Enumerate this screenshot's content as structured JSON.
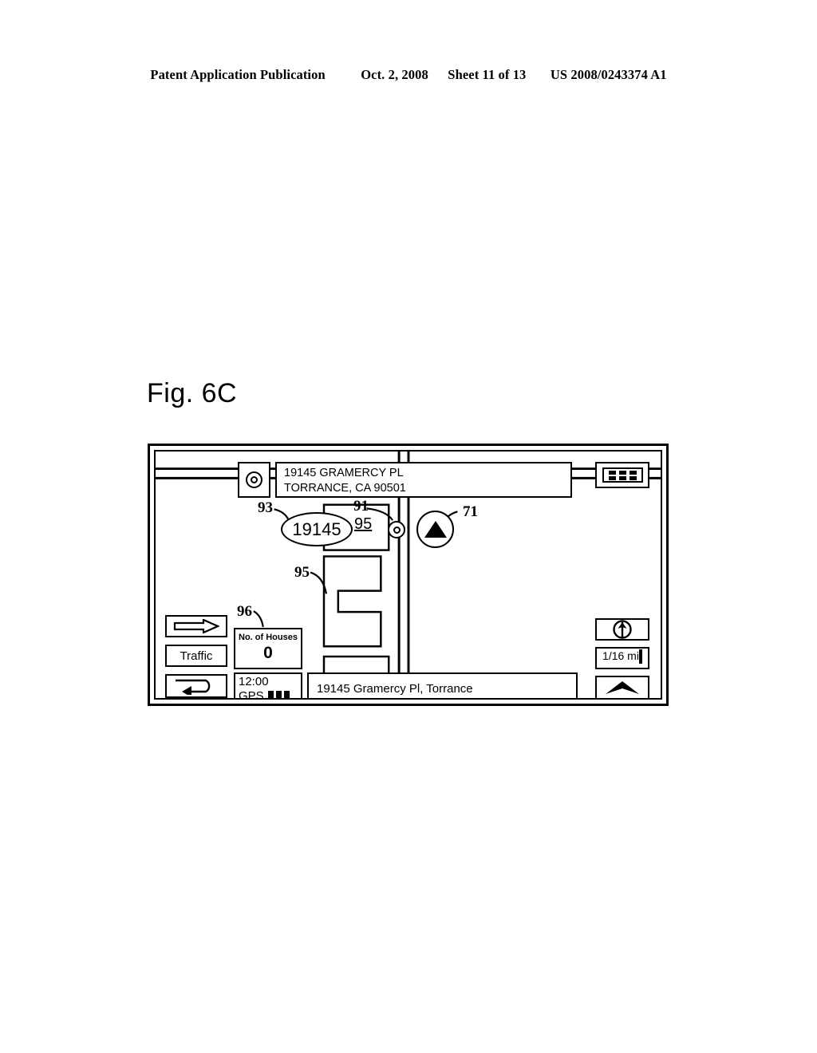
{
  "header": {
    "publication": "Patent Application Publication",
    "date": "Oct. 2, 2008",
    "sheet": "Sheet 11 of 13",
    "patent_number": "US 2008/0243374 A1"
  },
  "figure": {
    "label": "Fig. 6C"
  },
  "device": {
    "address_bar": {
      "icon": "target-ring-icon",
      "line1": "19145 GRAMERCY PL",
      "line2": "TORRANCE, CA 90501"
    },
    "menu_button": {
      "icon": "grid-menu-icon",
      "dots": 6
    },
    "map": {
      "house_number_callout": "19145",
      "parcel_label": "95",
      "poi_icon": "target-ring-icon",
      "vehicle_icon": "vehicle-triangle-icon"
    },
    "left_controls": [
      {
        "name": "route-arrow-button",
        "icon": "right-arrow-icon",
        "label": ""
      },
      {
        "name": "traffic-button",
        "icon": "",
        "label": "Traffic"
      },
      {
        "name": "uturn-button",
        "icon": "u-turn-arrow-icon",
        "label": ""
      }
    ],
    "houses_box": {
      "title": "No. of Houses",
      "value": "0"
    },
    "gps_box": {
      "time": "12:00",
      "label": "GPS",
      "signal_bars": 3
    },
    "status_bar": {
      "text": "19145 Gramercy Pl, Torrance"
    },
    "right_controls": {
      "compass": {
        "icon": "compass-north-up-icon"
      },
      "scale": {
        "label": "1/16 mi"
      },
      "chevron": {
        "icon": "up-chevron-icon"
      }
    }
  },
  "reference_numerals": [
    {
      "id": "ref-93",
      "text": "93"
    },
    {
      "id": "ref-91",
      "text": "91"
    },
    {
      "id": "ref-71",
      "text": "71"
    },
    {
      "id": "ref-95-map",
      "text": "95"
    },
    {
      "id": "ref-96",
      "text": "96"
    }
  ]
}
